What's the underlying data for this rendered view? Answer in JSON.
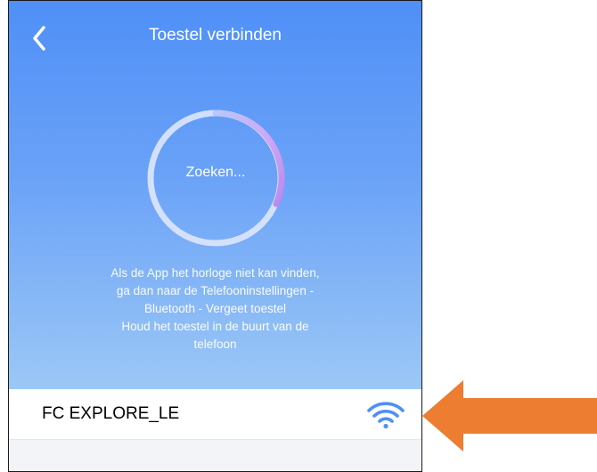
{
  "header": {
    "back_icon": "chevron-left-icon",
    "title": "Toestel verbinden"
  },
  "search": {
    "status": "Zoeken..."
  },
  "help": {
    "lines": [
      "Als de App het horloge niet kan vinden,",
      "ga dan naar de Telefooninstellingen -",
      "Bluetooth - Vergeet toestel",
      "Houd het toestel in de buurt van de",
      "telefoon"
    ]
  },
  "devices": [
    {
      "name": "FC EXPLORE_LE",
      "signal_icon": "wifi-signal-icon"
    }
  ],
  "annotation": {
    "icon": "arrow-left-icon",
    "color": "#ed7d31"
  },
  "colors": {
    "header_top": "#4f8ff7",
    "header_bottom": "#9cc8f6",
    "ring_accent": "#c39af2",
    "signal_blue": "#4f8ff7"
  }
}
